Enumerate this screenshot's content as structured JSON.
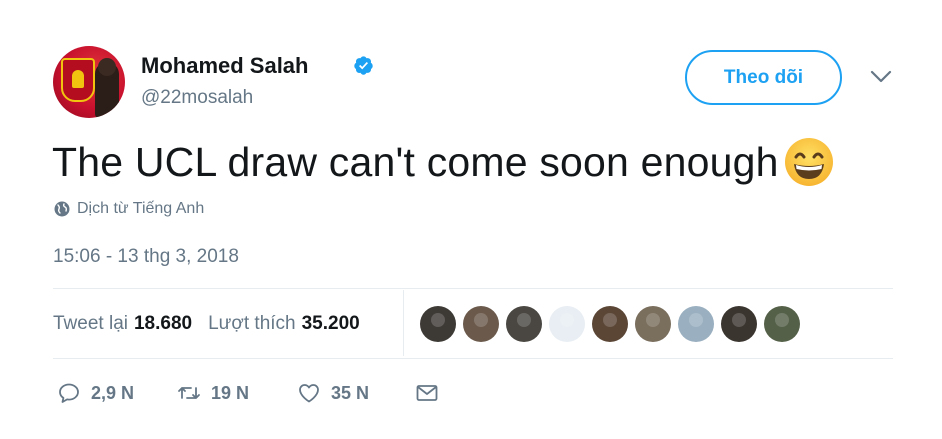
{
  "user": {
    "name": "Mohamed Salah",
    "handle": "@22mosalah"
  },
  "follow_button_label": "Theo dõi",
  "tweet": {
    "text": "The UCL draw can't come soon enough",
    "emoji": "grinning-face-with-smiling-eyes",
    "translate_label": "Dịch từ Tiếng Anh",
    "timestamp": "15:06 - 13 thg 3, 2018"
  },
  "stats": {
    "retweets_label": "Tweet lại",
    "retweets_count": "18.680",
    "likes_label": "Lượt thích",
    "likes_count": "35.200"
  },
  "likers": [
    {
      "color": "#3d3a36"
    },
    {
      "color": "#6b5a4c"
    },
    {
      "color": "#4a4742"
    },
    {
      "color": "#e8eef3"
    },
    {
      "color": "#5b4636"
    },
    {
      "color": "#7a6e5d"
    },
    {
      "color": "#9ab0c0"
    },
    {
      "color": "#3b352f"
    },
    {
      "color": "#556048"
    }
  ],
  "actions": {
    "reply_count": "2,9 N",
    "retweet_count": "19 N",
    "like_count": "35 N"
  },
  "colors": {
    "accent": "#1da1f2",
    "secondary_text": "#657786",
    "primary_text": "#14171a"
  }
}
